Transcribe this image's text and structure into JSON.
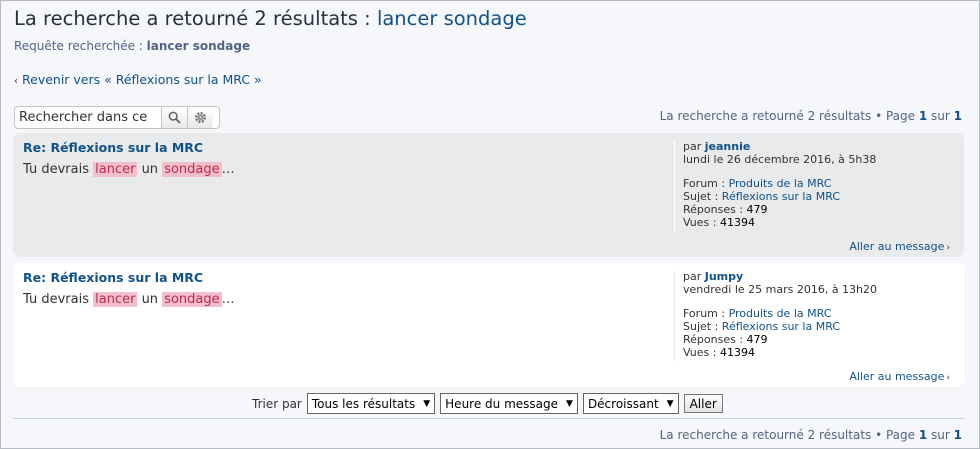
{
  "header": {
    "title_prefix": "La recherche a retourné 2 résultats : ",
    "title_query": "lancer sondage",
    "query_label": "Requête recherchée : ",
    "query_value": "lancer sondage"
  },
  "back_link": {
    "chevron": "‹",
    "label": "Revenir vers « Réflexions sur la MRC »"
  },
  "search": {
    "value": "Rechercher dans ce",
    "search_icon": "search-icon",
    "settings_icon": "gear-icon"
  },
  "pagination": {
    "prefix": "La recherche a retourné 2 résultats • Page ",
    "current": "1",
    "middle": " sur ",
    "total": "1"
  },
  "posts": [
    {
      "title": "Re: Réflexions sur la MRC",
      "body_1": "Tu devrais ",
      "hl_1": "lancer",
      "body_2": " un ",
      "hl_2": "sondage",
      "body_3": "…",
      "by": "par ",
      "author": "jeannie",
      "date": "lundi le 26 décembre 2016, à 5h38",
      "forum_label": "Forum : ",
      "forum": "Produits de la MRC",
      "topic_label": "Sujet : ",
      "topic": "Réflexions sur la MRC",
      "replies_label": "Réponses : ",
      "replies": "479",
      "views_label": "Vues : ",
      "views": "41394",
      "goto": "Aller au message",
      "goto_chevron": "›"
    },
    {
      "title": "Re: Réflexions sur la MRC",
      "body_1": "Tu devrais ",
      "hl_1": "lancer",
      "body_2": " un ",
      "hl_2": "sondage",
      "body_3": "…",
      "by": "par ",
      "author": "Jumpy",
      "date": "vendredi le 25 mars 2016, à 13h20",
      "forum_label": "Forum : ",
      "forum": "Produits de la MRC",
      "topic_label": "Sujet : ",
      "topic": "Réflexions sur la MRC",
      "replies_label": "Réponses : ",
      "replies": "479",
      "views_label": "Vues : ",
      "views": "41394",
      "goto": "Aller au message",
      "goto_chevron": "›"
    }
  ],
  "sort": {
    "label": "Trier par",
    "results": "Tous les résultats",
    "key": "Heure du message",
    "direction": "Décroissant",
    "dropdown_arrow": "▼",
    "go": "Aller"
  },
  "colors": {
    "link": "#105289",
    "highlight_bg": "#f3bfcc",
    "highlight_text": "#bc2a4d",
    "post_alt_bg": "#e9eaeb"
  }
}
